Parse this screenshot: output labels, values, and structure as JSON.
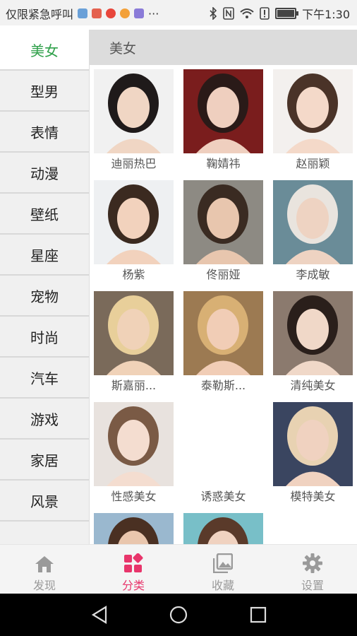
{
  "status_bar": {
    "carrier_text": "仅限紧急呼叫",
    "more": "···",
    "time": "下午1:30"
  },
  "sidebar": {
    "items": [
      {
        "label": "美女",
        "active": true
      },
      {
        "label": "型男"
      },
      {
        "label": "表情"
      },
      {
        "label": "动漫"
      },
      {
        "label": "壁纸"
      },
      {
        "label": "星座"
      },
      {
        "label": "宠物"
      },
      {
        "label": "时尚"
      },
      {
        "label": "汽车"
      },
      {
        "label": "游戏"
      },
      {
        "label": "家居"
      },
      {
        "label": "风景"
      }
    ]
  },
  "header": {
    "title": "美女"
  },
  "grid": {
    "items": [
      {
        "label": "迪丽热巴"
      },
      {
        "label": "鞠婧祎"
      },
      {
        "label": "赵丽颖"
      },
      {
        "label": "杨紫"
      },
      {
        "label": "佟丽娅"
      },
      {
        "label": "李成敏"
      },
      {
        "label": "斯嘉丽..."
      },
      {
        "label": "泰勒斯..."
      },
      {
        "label": "清纯美女"
      },
      {
        "label": "性感美女"
      },
      {
        "label": "诱惑美女"
      },
      {
        "label": "模特美女"
      },
      {
        "label": ""
      },
      {
        "label": ""
      }
    ]
  },
  "tabs": [
    {
      "label": "发现",
      "icon": "home-icon"
    },
    {
      "label": "分类",
      "icon": "category-icon",
      "active": true
    },
    {
      "label": "收藏",
      "icon": "gallery-icon"
    },
    {
      "label": "设置",
      "icon": "gear-icon"
    }
  ],
  "colors": {
    "active_tab": "#e8356b",
    "active_sidebar": "#2fa04a",
    "inactive": "#9a9a9a"
  }
}
